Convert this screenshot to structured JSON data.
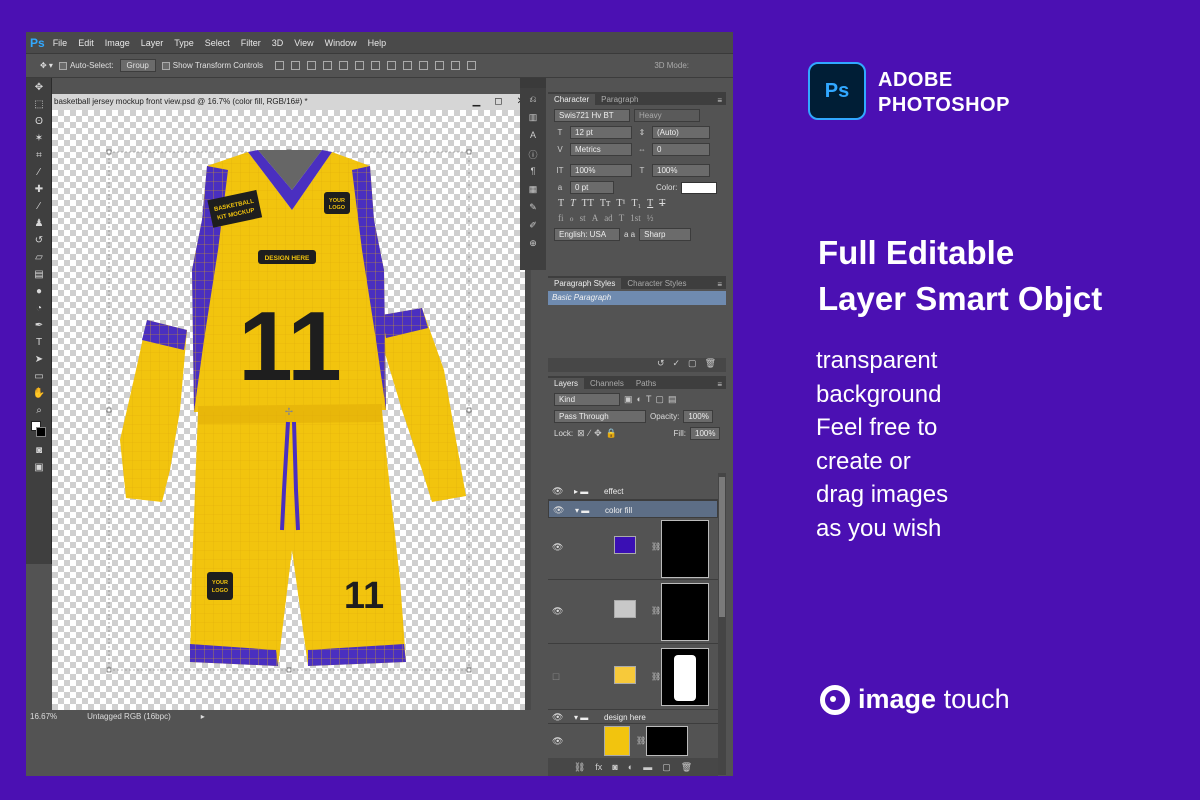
{
  "photoshop": {
    "app_logo": "Ps",
    "menu": [
      "File",
      "Edit",
      "Image",
      "Layer",
      "Type",
      "Select",
      "Filter",
      "3D",
      "View",
      "Window",
      "Help"
    ],
    "options_bar": {
      "auto_select_label": "Auto-Select:",
      "auto_select_value": "Group",
      "show_transform_label": "Show Transform Controls",
      "mode_3d_label": "3D Mode:"
    },
    "document": {
      "title": "basketball jersey mockup front view.psd @ 16.7% (color fill, RGB/16#) *",
      "minimize": "▁",
      "restore": "◻",
      "close": "✕"
    },
    "status": {
      "zoom": "16.67%",
      "profile": "Untagged RGB (16bpc)"
    },
    "character_panel": {
      "tabs": [
        "Character",
        "Paragraph"
      ],
      "font_family": "Swis721 Hv BT",
      "font_style": "Heavy",
      "font_size": "12 pt",
      "leading": "(Auto)",
      "kerning": "Metrics",
      "tracking": "0",
      "vertical_scale": "100%",
      "horizontal_scale": "100%",
      "baseline_shift": "0 pt",
      "color_label": "Color:",
      "language": "English: USA",
      "aa_label": "a a",
      "antialias": "Sharp"
    },
    "paragraph_styles_panel": {
      "tabs": [
        "Paragraph Styles",
        "Character Styles"
      ],
      "items": [
        "Basic Paragraph"
      ]
    },
    "layers_panel": {
      "tabs": [
        "Layers",
        "Channels",
        "Paths"
      ],
      "filter": "Kind",
      "blend_mode": "Pass Through",
      "opacity_label": "Opacity:",
      "opacity": "100%",
      "lock_label": "Lock:",
      "fill_label": "Fill:",
      "fill": "100%",
      "groups": [
        {
          "name": "effect"
        },
        {
          "name": "color fill"
        },
        {
          "name": "design here"
        }
      ],
      "swatch_colors": [
        "#3a0fb4",
        "#c8c8c8",
        "#f7c93a"
      ]
    }
  },
  "jersey": {
    "badge_text": "BASKETBALL KIT MOCKUP",
    "chest_logo": "YOUR LOGO",
    "design_label": "DESIGN HERE",
    "number": "11",
    "shorts_logo": "YOUR LOGO",
    "shorts_number": "11",
    "colors": {
      "body": "#f2c40e",
      "trim": "#4a2fc0",
      "number": "#1e1e1e"
    }
  },
  "promo": {
    "brand_line1": "ADOBE",
    "brand_line2": "PHOTOSHOP",
    "badge": "Ps",
    "headline_line1": "Full Editable",
    "headline_line2": "Layer Smart Objct",
    "desc_lines": [
      "transparent",
      "background",
      "Feel free to",
      "create or",
      "drag images",
      "as you wish"
    ],
    "logo_bold": "image",
    "logo_light": "touch"
  },
  "colors": {
    "background": "#4b10b3",
    "ps_blue": "#31a8ff"
  }
}
